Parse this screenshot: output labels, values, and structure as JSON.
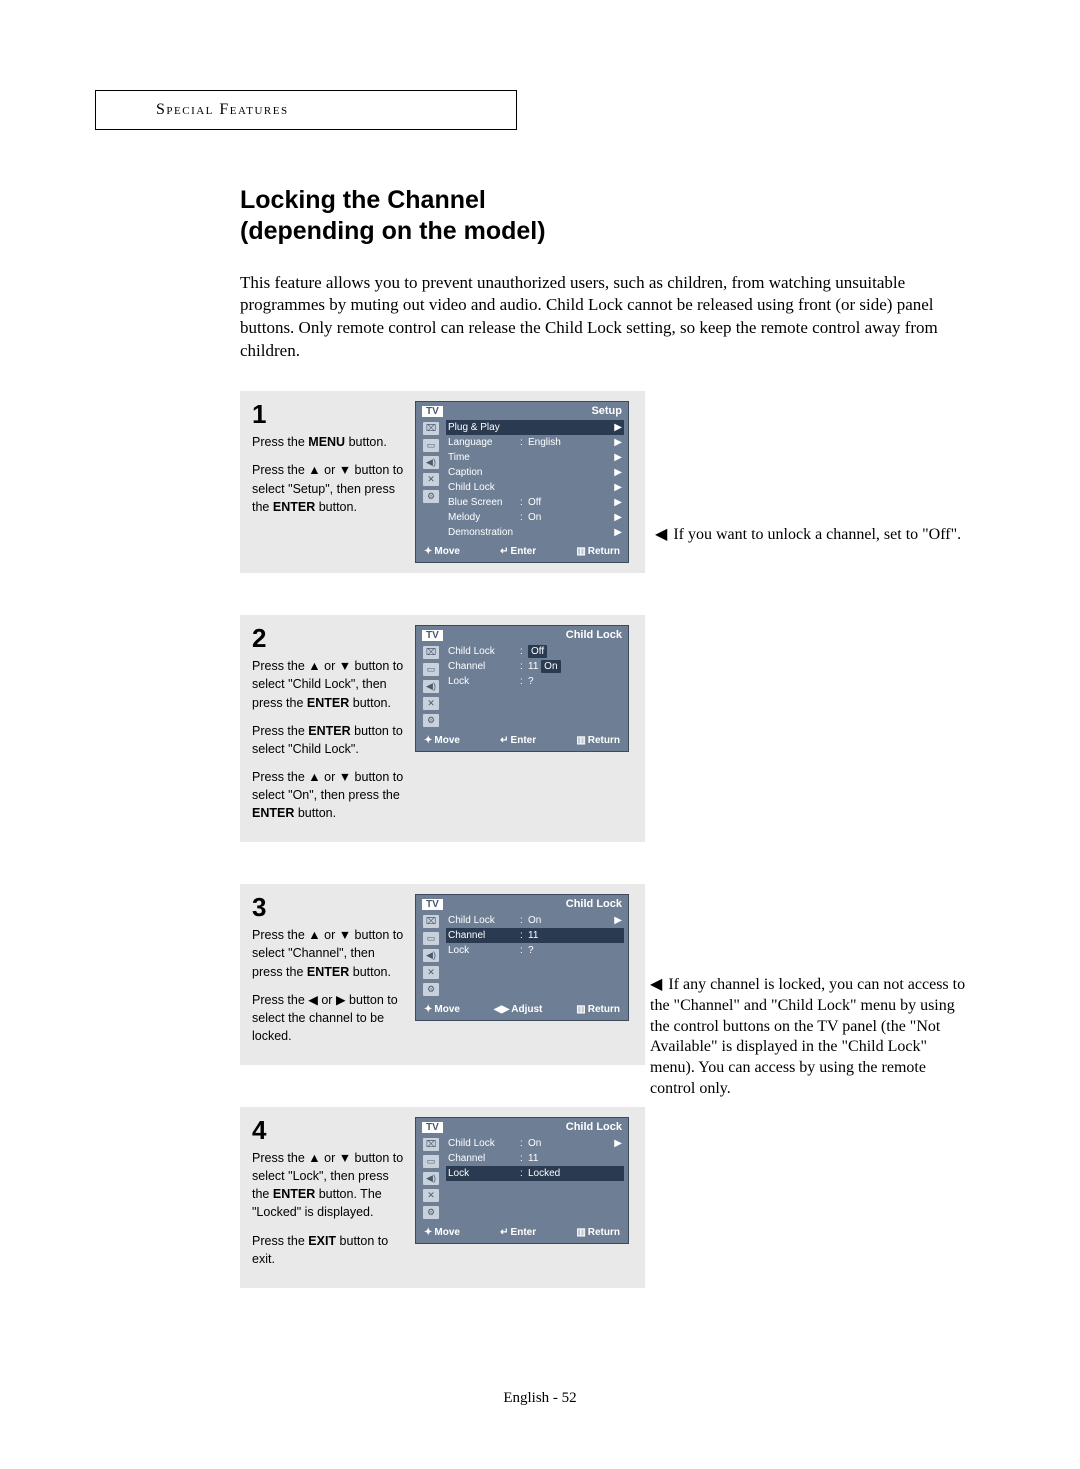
{
  "header": "Special Features",
  "title_line1": "Locking the Channel",
  "title_line2": "(depending on the model)",
  "intro": "This feature allows you to prevent unauthorized users, such as children, from watching unsuitable programmes by muting out video and audio. Child Lock cannot be released using front (or side) panel buttons. Only remote control can release the Child Lock setting, so keep the remote control away from children.",
  "steps": {
    "s1": {
      "num": "1",
      "p1a": "Press the ",
      "p1b": "MENU",
      "p1c": " button.",
      "p2a": "Press the ▲ or ▼ button to select \"Setup\", then press the ",
      "p2b": "ENTER",
      "p2c": " button.",
      "osd_title": "Setup",
      "rows": {
        "r0": {
          "label": "Plug & Play",
          "val": "",
          "arrow": "▶"
        },
        "r1": {
          "label": "Language",
          "val": "English",
          "arrow": "▶"
        },
        "r2": {
          "label": "Time",
          "val": "",
          "arrow": "▶"
        },
        "r3": {
          "label": "Caption",
          "val": "",
          "arrow": "▶"
        },
        "r4": {
          "label": "Child Lock",
          "val": "",
          "arrow": "▶"
        },
        "r5": {
          "label": "Blue Screen",
          "val": "Off",
          "arrow": "▶"
        },
        "r6": {
          "label": "Melody",
          "val": "On",
          "arrow": "▶"
        },
        "r7": {
          "label": "Demonstration",
          "val": "",
          "arrow": "▶"
        }
      },
      "footer": {
        "a": "Move",
        "b": "Enter",
        "c": "Return"
      }
    },
    "s2": {
      "num": "2",
      "p1a": "Press the ▲ or ▼ button to select \"Child Lock\", then press the ",
      "p1b": "ENTER",
      "p1c": " button.",
      "p2a": "Press the ",
      "p2b": "ENTER",
      "p2c": " button to select \"Child Lock\".",
      "p3a": "Press the ▲ or ▼ button to select \"On\", then press the ",
      "p3b": "ENTER",
      "p3c": " button.",
      "osd_title": "Child Lock",
      "rows": {
        "r0": {
          "label": "Child Lock",
          "val_off": "Off",
          "val_on": "On"
        },
        "r1": {
          "label": "Channel",
          "val": "11"
        },
        "r2": {
          "label": "Lock",
          "val": "?"
        }
      },
      "footer": {
        "a": "Move",
        "b": "Enter",
        "c": "Return"
      }
    },
    "s3": {
      "num": "3",
      "p1a": "Press the ▲ or ▼ button to select \"Channel\", then press the ",
      "p1b": "ENTER",
      "p1c": " button.",
      "p2": "Press the ◀ or ▶ button to select the channel to be locked.",
      "osd_title": "Child Lock",
      "rows": {
        "r0": {
          "label": "Child Lock",
          "val": "On",
          "arrow": "▶"
        },
        "r1": {
          "label": "Channel",
          "val": "11"
        },
        "r2": {
          "label": "Lock",
          "val": "?"
        }
      },
      "footer": {
        "a": "Move",
        "b": "Adjust",
        "c": "Return"
      }
    },
    "s4": {
      "num": "4",
      "p1a": "Press the ▲ or ▼ button to select \"Lock\", then press the ",
      "p1b": "ENTER",
      "p1c": " button. The \"Locked\" is displayed.",
      "p2a": "Press the ",
      "p2b": "EXIT",
      "p2c": " button to exit.",
      "osd_title": "Child Lock",
      "rows": {
        "r0": {
          "label": "Child Lock",
          "val": "On",
          "arrow": "▶"
        },
        "r1": {
          "label": "Channel",
          "val": "11"
        },
        "r2": {
          "label": "Lock",
          "val": "Locked"
        }
      },
      "footer": {
        "a": "Move",
        "b": "Enter",
        "c": "Return"
      }
    }
  },
  "notes": {
    "n1": "If you want to unlock a channel, set to \"Off\".",
    "n2": "If any channel is locked, you can not access to the \"Channel\" and \"Child Lock\" menu by using the control buttons on the TV panel (the \"Not Available\" is displayed in the \"Child Lock\" menu). You can access by using the remote control only."
  },
  "osd_tv": "TV",
  "glyphs": {
    "updown": "✦",
    "enter": "↵",
    "return": "▥",
    "lr": "◀▶"
  },
  "page_footer": "English - 52"
}
